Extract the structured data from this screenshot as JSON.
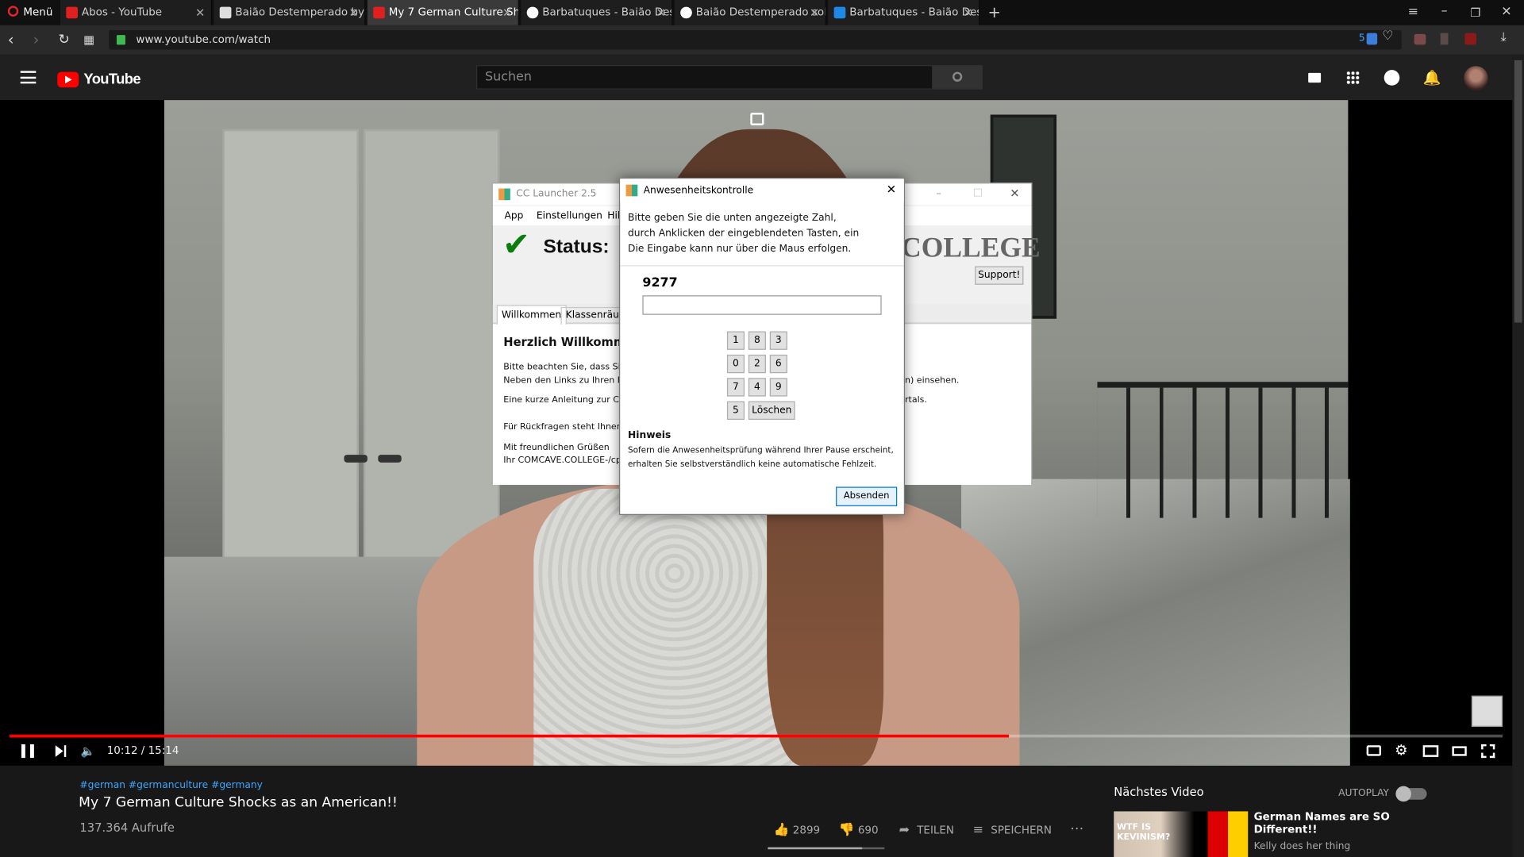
{
  "browser": {
    "menu_label": "Menü",
    "tabs": [
      {
        "label": "Abos - YouTube"
      },
      {
        "label": "Baião Destemperado by B"
      },
      {
        "label": "My 7 German Culture Sho"
      },
      {
        "label": "Barbatuques - Baião Deste"
      },
      {
        "label": "Baião Destemperado solo"
      },
      {
        "label": "Barbatuques - Baião Deste"
      }
    ],
    "url": "www.youtube.com/watch",
    "badge_count": "5"
  },
  "youtube": {
    "logo": "YouTube",
    "search_placeholder": "Suchen",
    "player": {
      "time": "10:12 / 15:14",
      "progress_fraction": 0.669
    },
    "video": {
      "hashtags": "#german #germanculture #germany",
      "title": "My 7 German Culture Shocks as an American!!",
      "views": "137.364 Aufrufe",
      "likes": "2899",
      "dislikes": "690",
      "share_label": "TEILEN",
      "save_label": "SPEICHERN"
    },
    "next": {
      "heading": "Nächstes Video",
      "autoplay_label": "AUTOPLAY",
      "video_title": "German Names are SO Different!!",
      "channel": "Kelly does her thing",
      "thumb_text": "WTF IS KEVINISM?"
    }
  },
  "launcher": {
    "window_title": "CC Launcher 2.5",
    "menu": [
      "App",
      "Einstellungen",
      "Hil"
    ],
    "status_label": "Status:",
    "brand": "COLLEGE",
    "support_button": "Support!",
    "tabs": [
      "Willkommen",
      "Klassenräume"
    ],
    "heading": "Herzlich Willkomm",
    "lines": [
      "Bitte beachten Sie, dass Sie",
      "Neben den Links zu Ihren Kl",
      "Eine kurze Anleitung zur CC",
      "Für Rückfragen steht Ihnen",
      "Mit freundlichen Grüßen",
      "Ihr COMCAVE.COLLEGE-/cp"
    ],
    "right_fragments": [
      "n) einsehen.",
      "rtals."
    ]
  },
  "presence": {
    "title": "Anwesenheitskontrolle",
    "instructions": [
      "Bitte geben Sie die unten angezeigte Zahl,",
      "durch Anklicken der eingeblendeten Tasten, ein",
      "Die Eingabe kann nur über die Maus erfolgen."
    ],
    "number": "9277",
    "input_value": "",
    "keys": [
      "1",
      "8",
      "3",
      "0",
      "2",
      "6",
      "7",
      "4",
      "9",
      "5"
    ],
    "delete_label": "Löschen",
    "hint_heading": "Hinweis",
    "hint_lines": [
      "Sofern die Anwesenheitsprüfung während Ihrer Pause erscheint,",
      "erhalten Sie selbstverständlich keine automatische Fehlzeit."
    ],
    "submit_label": "Absenden"
  },
  "colors": {
    "accent_red": "#ff0000",
    "dialog_button_border": "#0078d7",
    "status_check": "#0a7d0a"
  }
}
